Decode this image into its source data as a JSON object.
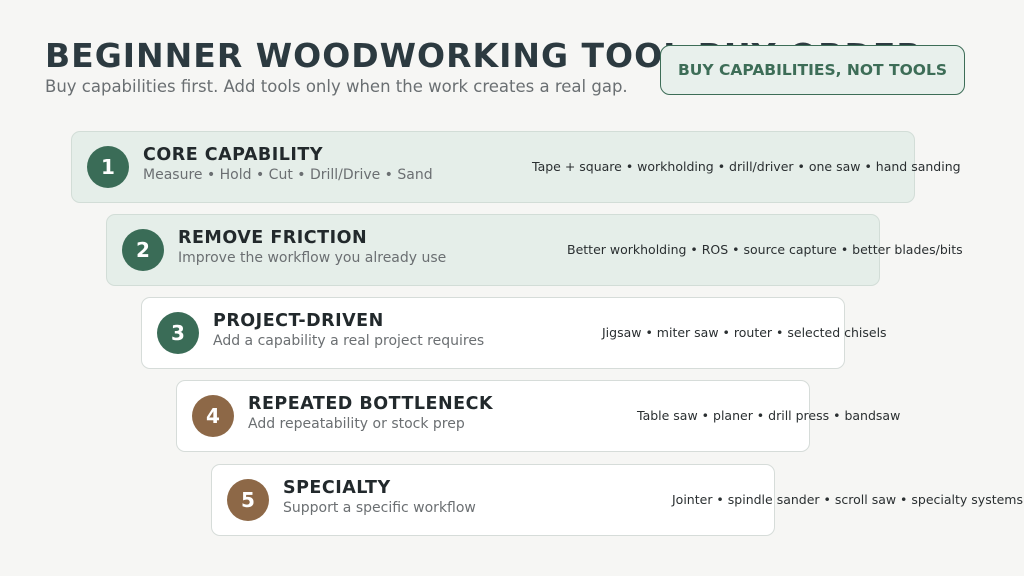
{
  "header": {
    "title": "BEGINNER WOODWORKING TOOL BUY ORDER",
    "subtitle": "Buy capabilities first. Add tools only when the work creates a real gap.",
    "badge": "BUY CAPABILITIES, NOT TOOLS"
  },
  "tiers": [
    {
      "number": "1",
      "title": "CORE CAPABILITY",
      "description": "Measure • Hold • Cut • Drill/Drive • Sand",
      "tools": "Tape + square • workholding • drill/driver • one saw • hand sanding"
    },
    {
      "number": "2",
      "title": "REMOVE FRICTION",
      "description": "Improve the workflow you already use",
      "tools": "Better workholding • ROS • source capture • better blades/bits"
    },
    {
      "number": "3",
      "title": "PROJECT-DRIVEN",
      "description": "Add a capability a real project requires",
      "tools": "Jigsaw • miter saw • router • selected chisels"
    },
    {
      "number": "4",
      "title": "REPEATED BOTTLENECK",
      "description": "Add repeatability or stock prep",
      "tools": "Table saw • planer • drill press • bandsaw"
    },
    {
      "number": "5",
      "title": "SPECIALTY",
      "description": "Support a specific workflow",
      "tools": "Jointer • spindle sander • scroll saw • specialty systems"
    }
  ],
  "colors": {
    "green": "#3a6c57",
    "brown": "#8d6847",
    "tint": "#e5eee9"
  }
}
